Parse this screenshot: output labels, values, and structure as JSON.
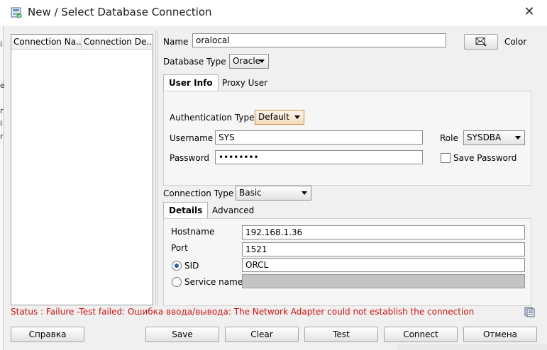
{
  "window": {
    "title": "New / Select Database Connection",
    "close_label": "✕"
  },
  "background_fragments": [
    "i",
    "e",
    "r",
    "l",
    "r"
  ],
  "conn_table": {
    "columns": [
      "Connection Na...",
      "Connection De..."
    ]
  },
  "form": {
    "name_label": "Name",
    "name_value": "oralocal",
    "color_label": "Color",
    "db_type_label": "Database Type",
    "db_type_value": "Oracle",
    "tabs": [
      "User Info",
      "Proxy User"
    ],
    "auth_type_label": "Authentication Type",
    "auth_type_value": "Default",
    "username_label": "Username",
    "username_value": "SYS",
    "role_label": "Role",
    "role_value": "SYSDBA",
    "password_label": "Password",
    "password_value": "••••••••",
    "save_password_label": "Save Password",
    "conn_type_label": "Connection Type",
    "conn_type_value": "Basic",
    "detail_tabs": [
      "Details",
      "Advanced"
    ],
    "hostname_label": "Hostname",
    "hostname_value": "192.168.1.36",
    "port_label": "Port",
    "port_value": "1521",
    "sid_label": "SID",
    "sid_value": "ORCL",
    "service_label": "Service name",
    "service_value": ""
  },
  "status": {
    "text": "Status : Failure -Test failed: Ошибка ввода/вывода: The Network Adapter could not establish the connection"
  },
  "buttons": {
    "help": "Справка",
    "save": "Save",
    "clear": "Clear",
    "test": "Test",
    "connect": "Connect",
    "cancel": "Отмена"
  },
  "colors": {
    "status_error": "#d11212",
    "combo_active": "#d08a3c",
    "radio_selected": "#2a5fa8"
  }
}
